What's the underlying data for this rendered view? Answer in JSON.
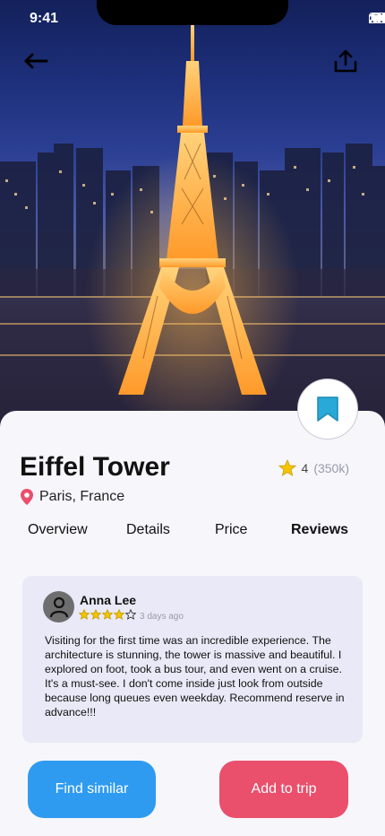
{
  "status": {
    "time": "9:41"
  },
  "place": {
    "title": "Eiffel Tower",
    "location": "Paris, France",
    "rating": "4",
    "rating_count": "(350k)"
  },
  "tabs": [
    {
      "label": "Overview"
    },
    {
      "label": "Details"
    },
    {
      "label": "Price"
    },
    {
      "label": "Reviews",
      "active": true
    }
  ],
  "review": {
    "author": "Anna Lee",
    "stars": 4,
    "max_stars": 5,
    "time_ago": "3 days ago",
    "text": "Visiting for the first time was an incredible experience. The architecture is stunning, the tower is massive and beautiful. I explored on foot, took a bus tour, and even went on a cruise. It's a must-see. I don't come inside just look from outside because long queues even weekday. Recommend reserve in advance!!!"
  },
  "actions": {
    "find_similar": "Find similar",
    "add_to_trip": "Add to trip"
  },
  "icons": {
    "back": "arrow-left-icon",
    "share": "share-icon",
    "bookmark": "bookmark-icon",
    "location": "location-pin-icon",
    "star": "star-icon"
  },
  "colors": {
    "primary_blue": "#2f9bf0",
    "accent_red": "#ea4f6c",
    "bookmark": "#29a9d8",
    "star": "#f4c400",
    "review_bg": "#e9e9f7"
  }
}
